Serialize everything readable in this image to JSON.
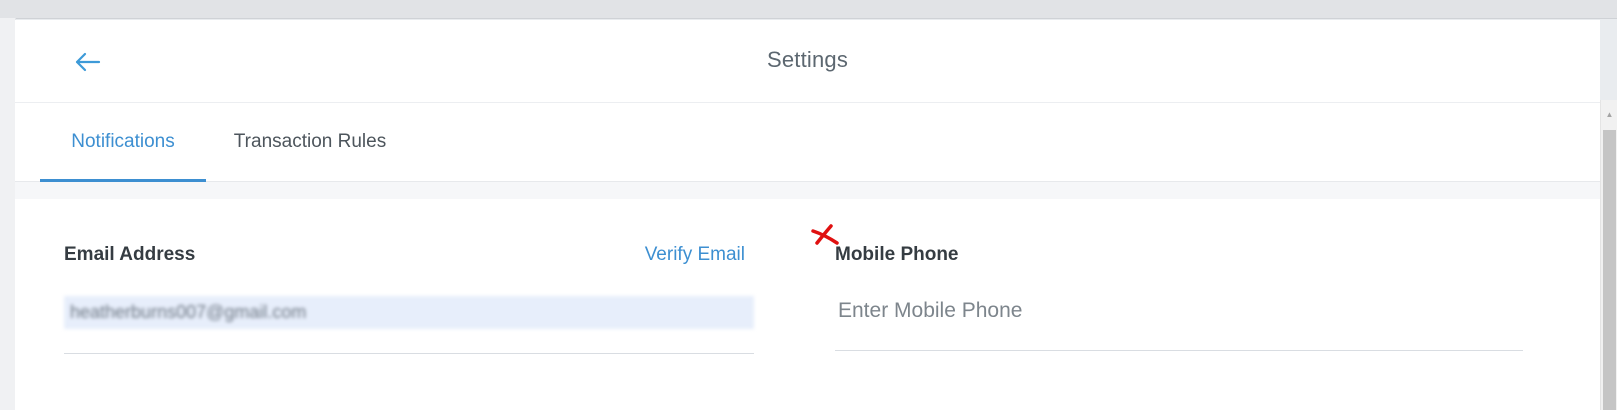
{
  "header": {
    "title": "Settings",
    "back_icon": "arrow-left-icon"
  },
  "tabs": [
    {
      "label": "Notifications",
      "active": true
    },
    {
      "label": "Transaction Rules",
      "active": false
    }
  ],
  "email": {
    "label": "Email Address",
    "verify_label": "Verify Email",
    "value": "heatherburns007@gmail.com"
  },
  "phone": {
    "label": "Mobile Phone",
    "placeholder": "Enter Mobile Phone",
    "value": ""
  },
  "colors": {
    "accent": "#3d8fd1",
    "annotation_mark": "#e01010",
    "input_highlight": "#e7eefb"
  }
}
